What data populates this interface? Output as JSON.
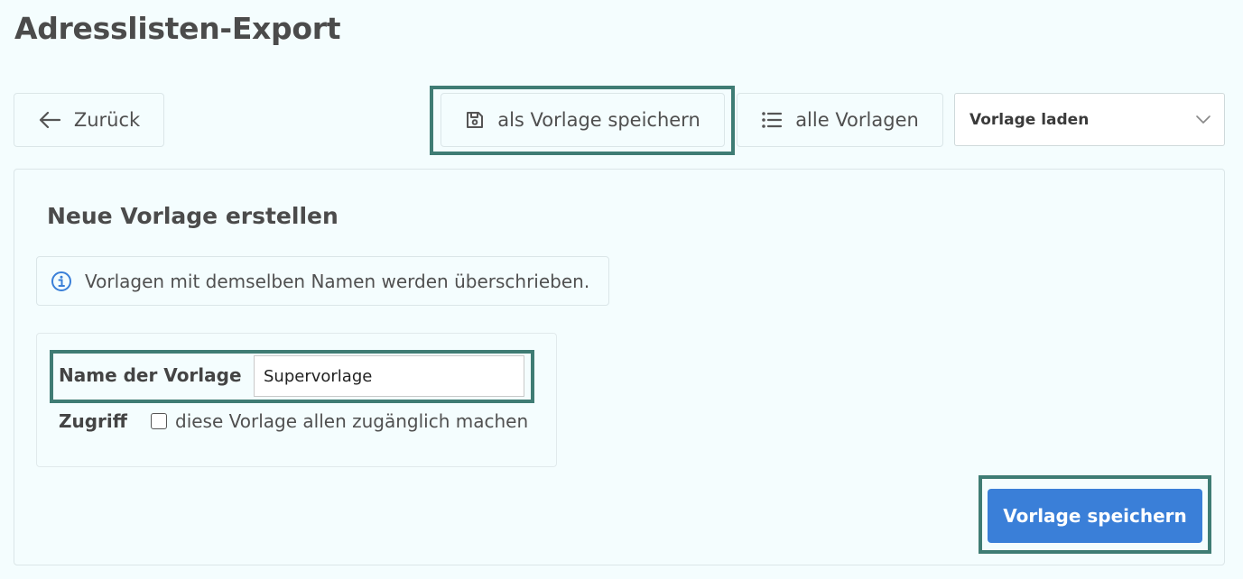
{
  "page": {
    "title": "Adresslisten-Export"
  },
  "toolbar": {
    "back_label": "Zurück",
    "save_template_label": "als Vorlage speichern",
    "all_templates_label": "alle Vorlagen",
    "load_template_selected": "Vorlage laden"
  },
  "panel": {
    "title": "Neue Vorlage erstellen",
    "info_text": "Vorlagen mit demselben Namen werden überschrieben.",
    "name_label": "Name der Vorlage",
    "name_value": "Supervorlage",
    "access_label": "Zugriff",
    "access_checkbox_label": "diese Vorlage allen zugänglich machen",
    "access_checked": false,
    "submit_label": "Vorlage speichern"
  },
  "icons": {
    "back": "arrow-left-icon",
    "save": "floppy-disk-icon",
    "list": "list-icon",
    "dropdown": "chevron-down-icon",
    "info": "info-circle-icon"
  },
  "colors": {
    "background": "#f4fdfe",
    "primary": "#3a7fd8",
    "highlight": "#3f7c74",
    "info_icon": "#3a7fd8"
  }
}
